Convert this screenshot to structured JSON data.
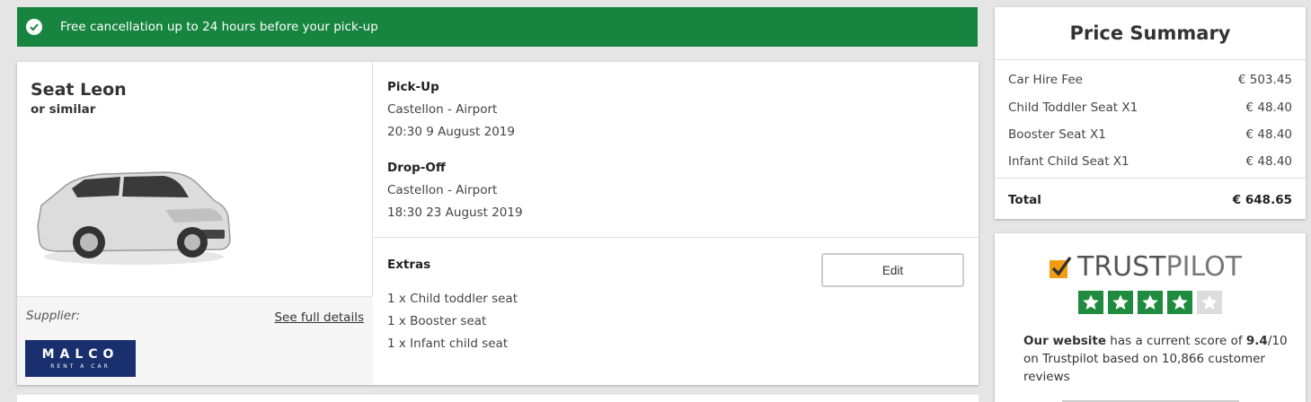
{
  "banner": {
    "text": "Free cancellation up to 24 hours before your pick-up",
    "color": "#17843f"
  },
  "car": {
    "name": "Seat Leon",
    "subtitle": "or similar",
    "supplier_label": "Supplier:",
    "details_link": "See full details",
    "supplier_logo": {
      "name": "MALCO",
      "tagline": "RENT A CAR"
    }
  },
  "pickup": {
    "label": "Pick-Up",
    "location": "Castellon - Airport",
    "datetime": "20:30 9 August 2019"
  },
  "dropoff": {
    "label": "Drop-Off",
    "location": "Castellon - Airport",
    "datetime": "18:30 23 August 2019"
  },
  "extras": {
    "label": "Extras",
    "edit_label": "Edit",
    "items": [
      "1 x Child toddler seat",
      "1 x Booster seat",
      "1 x Infant child seat"
    ]
  },
  "price_summary": {
    "title": "Price Summary",
    "rows": [
      {
        "label": "Car Hire Fee",
        "amount": "€ 503.45"
      },
      {
        "label": "Child Toddler Seat X1",
        "amount": "€ 48.40"
      },
      {
        "label": "Booster Seat X1",
        "amount": "€ 48.40"
      },
      {
        "label": "Infant Child Seat X1",
        "amount": "€ 48.40"
      }
    ],
    "total_label": "Total",
    "total_amount": "€ 648.65"
  },
  "trustpilot": {
    "brand_a": "TRUST",
    "brand_b": "PILOT",
    "stars_filled": 4,
    "stars_total": 5,
    "star_color": "#1e8b3f",
    "text_bold": "Our website",
    "text_mid": " has a current score of ",
    "score": "9.4",
    "text_end": "/10 on Trustpilot based on 10,866 customer reviews"
  }
}
